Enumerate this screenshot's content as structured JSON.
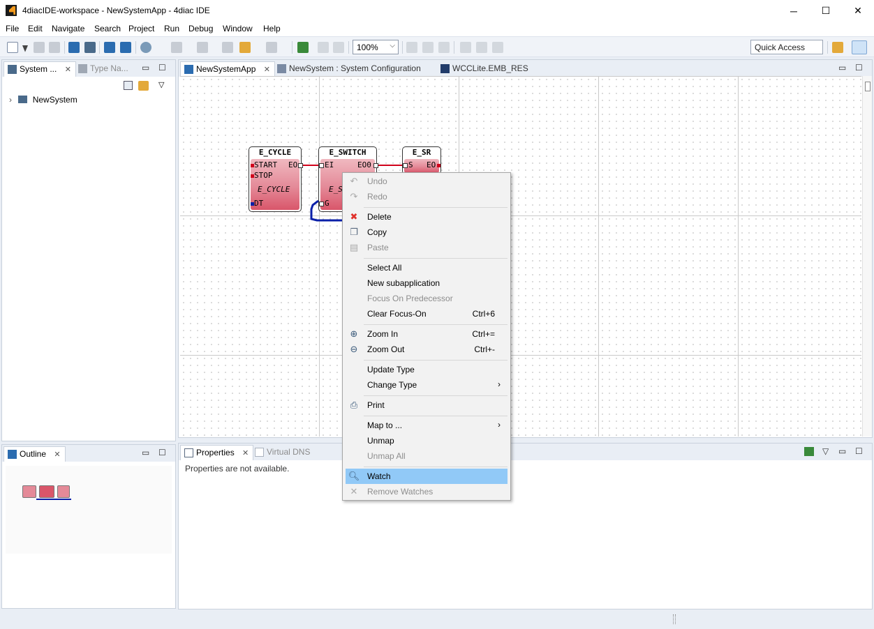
{
  "window": {
    "title": "4diacIDE-workspace - NewSystemApp - 4diac IDE",
    "minimize": "─",
    "maximize": "☐",
    "close": "✕"
  },
  "menubar": [
    "File",
    "Edit",
    "Navigate",
    "Search",
    "Project",
    "Run",
    "Debug",
    "Window",
    "Help"
  ],
  "toolbar": {
    "zoom_value": "100%",
    "quick_access": "Quick Access"
  },
  "left_panel": {
    "tabs": [
      "System ...",
      "Type Na..."
    ],
    "tree": [
      {
        "label": "NewSystem"
      }
    ]
  },
  "editor": {
    "tabs": [
      "NewSystemApp",
      "NewSystem : System Configuration",
      "WCCLite.EMB_RES"
    ],
    "blocks": [
      {
        "name": "E_CYCLE",
        "inputs": [
          "START",
          "STOP"
        ],
        "outputs": [
          "EO"
        ],
        "type_label": "E_CYCLE",
        "data_inputs": [
          "DT"
        ]
      },
      {
        "name": "E_SWITCH",
        "inputs": [
          "EI"
        ],
        "outputs": [
          "EO0"
        ],
        "type_label": "E_S",
        "data_inputs": [
          "G"
        ]
      },
      {
        "name": "E_SR",
        "inputs": [
          "S"
        ],
        "outputs": [
          "EO"
        ]
      }
    ]
  },
  "outline": {
    "tab": "Outline"
  },
  "bottom_panel": {
    "tabs": [
      "Properties",
      "Virtual DNS"
    ],
    "message": "Properties are not available."
  },
  "context_menu": {
    "items": [
      {
        "label": "Undo",
        "disabled": true,
        "icon": "undo-icon"
      },
      {
        "label": "Redo",
        "disabled": true,
        "icon": "redo-icon"
      },
      {
        "label": "Delete",
        "icon": "delete-icon"
      },
      {
        "label": "Copy",
        "icon": "copy-icon"
      },
      {
        "label": "Paste",
        "disabled": true,
        "icon": "paste-icon"
      },
      {
        "label": "Select All"
      },
      {
        "label": "New subapplication"
      },
      {
        "label": "Focus On Predecessor",
        "disabled": true
      },
      {
        "label": "Clear Focus-On",
        "accel": "Ctrl+6"
      },
      {
        "label": "Zoom In",
        "accel": "Ctrl+=",
        "icon": "zoom-in-icon"
      },
      {
        "label": "Zoom Out",
        "accel": "Ctrl+-",
        "icon": "zoom-out-icon"
      },
      {
        "label": "Update Type"
      },
      {
        "label": "Change Type",
        "submenu": true
      },
      {
        "label": "Print",
        "icon": "print-icon"
      },
      {
        "label": "Map to ...",
        "submenu": true
      },
      {
        "label": "Unmap"
      },
      {
        "label": "Unmap All",
        "disabled": true
      },
      {
        "label": "Watch",
        "selected": true,
        "icon": "watch-icon"
      },
      {
        "label": "Remove Watches",
        "disabled": true,
        "icon": "remove-watches-icon"
      }
    ],
    "submenu_arrow": "›"
  },
  "colors": {
    "accent_selected": "#91c9f7",
    "event_connection": "#d0021b",
    "data_connection": "#0a1fa8"
  }
}
